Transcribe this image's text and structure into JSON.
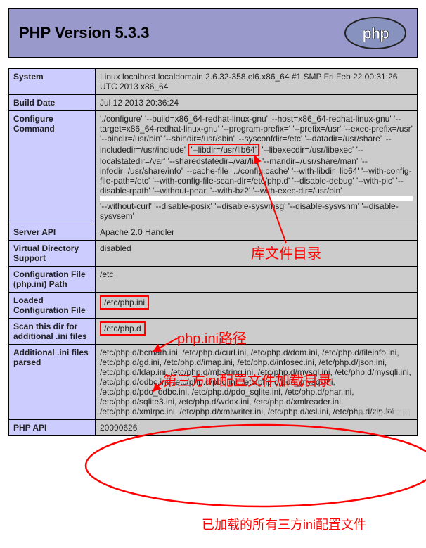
{
  "header": {
    "title": "PHP Version 5.3.3",
    "logo_name": "php-logo"
  },
  "rows": {
    "system": {
      "label": "System",
      "value": "Linux localhost.localdomain 2.6.32-358.el6.x86_64 #1 SMP Fri Feb 22 00:31:26 UTC 2013 x86_64"
    },
    "build_date": {
      "label": "Build Date",
      "value": "Jul 12 2013 20:36:24"
    },
    "configure": {
      "label": "Configure Command",
      "pre": "'./configure' '--build=x86_64-redhat-linux-gnu' '--host=x86_64-redhat-linux-gnu' '--target=x86_64-redhat-linux-gnu' '--program-prefix=' '--prefix=/usr' '--exec-prefix=/usr' '--bindir=/usr/bin' '--sbindir=/usr/sbin' '--sysconfdir=/etc' '--datadir=/usr/share' '--includedir=/usr/include' ",
      "boxed": "'--libdir=/usr/lib64'",
      "post": " '--libexecdir=/usr/libexec' '--localstatedir=/var' '--sharedstatedir=/var/lib' '--mandir=/usr/share/man' '--infodir=/usr/share/info' '--cache-file=../config.cache' '--with-libdir=lib64' '--with-config-file-path=/etc' '--with-config-file-scan-dir=/etc/php.d' '--disable-debug' '--with-pic' '--disable-rpath' '--without-pear' '--with-bz2' '--with-exec-dir=/usr/bin'",
      "post2": "'--without-curl' '--disable-posix' '--disable-sysvmsg' '--disable-sysvshm' '--disable-sysvsem'"
    },
    "server_api": {
      "label": "Server API",
      "value": "Apache 2.0 Handler"
    },
    "virtual_directory_support": {
      "label": "Virtual Directory Support",
      "value": "disabled"
    },
    "config_file_path": {
      "label": "Configuration File (php.ini) Path",
      "value": "/etc"
    },
    "loaded_config": {
      "label": "Loaded Configuration File",
      "value": "/etc/php.ini"
    },
    "scan_dir": {
      "label": "Scan this dir for additional .ini files",
      "value": "/etc/php.d"
    },
    "additional_ini": {
      "label": "Additional .ini files parsed",
      "value": "/etc/php.d/bcmath.ini, /etc/php.d/curl.ini, /etc/php.d/dom.ini, /etc/php.d/fileinfo.ini, /etc/php.d/gd.ini, /etc/php.d/imap.ini, /etc/php.d/infosec.ini, /etc/php.d/json.ini, /etc/php.d/ldap.ini, /etc/php.d/mbstring.ini, /etc/php.d/mysql.ini, /etc/php.d/mysqli.ini, /etc/php.d/odbc.ini, /etc/php.d/pdo.ini, /etc/php.d/pdo_mysql.ini, /etc/php.d/pdo_odbc.ini, /etc/php.d/pdo_sqlite.ini, /etc/php.d/phar.ini, /etc/php.d/sqlite3.ini, /etc/php.d/wddx.ini, /etc/php.d/xmlreader.ini, /etc/php.d/xmlrpc.ini, /etc/php.d/xmlwriter.ini, /etc/php.d/xsl.ini, /etc/php.d/zip.ini"
    },
    "php_api": {
      "label": "PHP API",
      "value": "20090626"
    }
  },
  "annotations": {
    "libdir_label": "库文件目录",
    "php_ini_label": "php.ini路径",
    "third_party_label": "第三方ini配置文件加载目录",
    "loaded_all_label": "已加载的所有三方ini配置文件"
  },
  "watermark": {
    "text": "php 中文网"
  }
}
